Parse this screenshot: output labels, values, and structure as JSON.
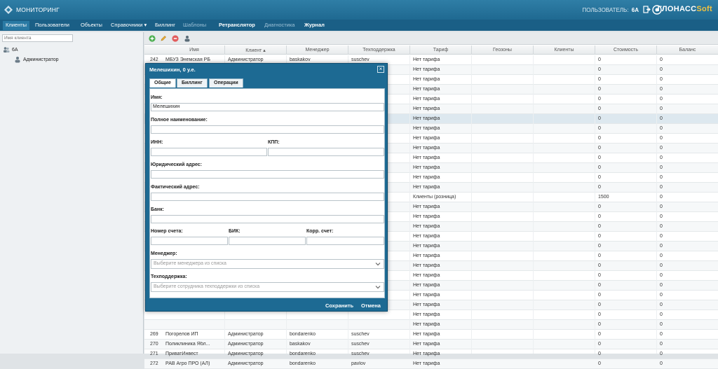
{
  "header": {
    "app_title": "МОНИТОРИНГ",
    "user_label": "ПОЛЬЗОВАТЕЛЬ:",
    "user_name": "6А",
    "brand_main": "ГЛОНАСС",
    "brand_soft": "Soft"
  },
  "menu": {
    "items": [
      "Клиенты",
      "Пользователи",
      "Объекты",
      "Справочники ▾",
      "Биллинг",
      "Шаблоны",
      "Ретранслятор",
      "Диагностика",
      "Журнал"
    ]
  },
  "left": {
    "search_placeholder": "Имя клиента",
    "tree_root": "6А",
    "tree_child": "Администратор"
  },
  "grid": {
    "columns": [
      "Имя",
      "Клиент ▴",
      "Менеджер",
      "Техподдержка",
      "Тариф",
      "Геозоны",
      "Клиенты",
      "Стоимость",
      "Баланс"
    ],
    "rows": [
      [
        "242",
        "МБУЗ Энемская РБ",
        "Администратор",
        "baskakov",
        "suschev",
        "Нет тарифа",
        "",
        "",
        "0",
        "0"
      ],
      [
        "",
        "",
        "",
        "",
        "",
        "Нет тарифа",
        "",
        "",
        "0",
        "0"
      ],
      [
        "",
        "",
        "",
        "",
        "",
        "Нет тарифа",
        "",
        "",
        "0",
        "0"
      ],
      [
        "",
        "",
        "",
        "",
        "",
        "Нет тарифа",
        "",
        "",
        "0",
        "0"
      ],
      [
        "",
        "",
        "",
        "",
        "",
        "Нет тарифа",
        "",
        "",
        "0",
        "0"
      ],
      [
        "",
        "",
        "",
        "",
        "",
        "Нет тарифа",
        "",
        "",
        "0",
        "0"
      ],
      [
        "",
        "",
        "",
        "",
        "",
        "Нет тарифа",
        "",
        "",
        "0",
        "0"
      ],
      [
        "",
        "",
        "",
        "",
        "",
        "Нет тарифа",
        "",
        "",
        "0",
        "0"
      ],
      [
        "",
        "",
        "",
        "",
        "",
        "Нет тарифа",
        "",
        "",
        "0",
        "0"
      ],
      [
        "",
        "",
        "",
        "",
        "",
        "Нет тарифа",
        "",
        "",
        "0",
        "0"
      ],
      [
        "",
        "",
        "",
        "",
        "",
        "Нет тарифа",
        "",
        "",
        "0",
        "0"
      ],
      [
        "",
        "",
        "",
        "",
        "",
        "Нет тарифа",
        "",
        "",
        "0",
        "0"
      ],
      [
        "",
        "",
        "",
        "",
        "",
        "Нет тарифа",
        "",
        "",
        "0",
        "0"
      ],
      [
        "",
        "",
        "",
        "",
        "",
        "Нет тарифа",
        "",
        "",
        "0",
        "0"
      ],
      [
        "",
        "",
        "",
        "",
        "",
        "Клиенты (розница)",
        "",
        "",
        "1500",
        "0"
      ],
      [
        "",
        "",
        "",
        "",
        "",
        "Нет тарифа",
        "",
        "",
        "0",
        "0"
      ],
      [
        "",
        "",
        "",
        "",
        "",
        "Нет тарифа",
        "",
        "",
        "0",
        "0"
      ],
      [
        "",
        "",
        "",
        "",
        "",
        "Нет тарифа",
        "",
        "",
        "0",
        "0"
      ],
      [
        "",
        "",
        "",
        "",
        "",
        "Нет тарифа",
        "",
        "",
        "0",
        "0"
      ],
      [
        "",
        "",
        "",
        "",
        "",
        "Нет тарифа",
        "",
        "",
        "0",
        "0"
      ],
      [
        "",
        "",
        "",
        "",
        "",
        "Нет тарифа",
        "",
        "",
        "0",
        "0"
      ],
      [
        "",
        "",
        "",
        "",
        "",
        "Нет тарифа",
        "",
        "",
        "0",
        "0"
      ],
      [
        "",
        "",
        "",
        "",
        "",
        "Нет тарифа",
        "",
        "",
        "0",
        "0"
      ],
      [
        "",
        "",
        "",
        "",
        "",
        "Нет тарифа",
        "",
        "",
        "0",
        "0"
      ],
      [
        "",
        "",
        "",
        "",
        "",
        "Нет тарифа",
        "",
        "",
        "0",
        "0"
      ],
      [
        "",
        "",
        "",
        "",
        "",
        "Нет тарифа",
        "",
        "",
        "0",
        "0"
      ],
      [
        "",
        "",
        "",
        "",
        "",
        "Нет тарифа",
        "",
        "",
        "0",
        "0"
      ],
      [
        "",
        "",
        "",
        "",
        "",
        "Нет тарифа",
        "",
        "",
        "0",
        "0"
      ],
      [
        "269",
        "Погорелов ИП",
        "Администратор",
        "bondarenko",
        "suschev",
        "Нет тарифа",
        "",
        "",
        "0",
        "0"
      ],
      [
        "270",
        "Поликлиника Ябл...",
        "Администратор",
        "baskakov",
        "suschev",
        "Нет тарифа",
        "",
        "",
        "0",
        "0"
      ],
      [
        "271",
        "ПриватИнвест",
        "Администратор",
        "bondarenko",
        "suschev",
        "Нет тарифа",
        "",
        "",
        "0",
        "0"
      ],
      [
        "272",
        "РАВ Агро ПРО (АЛ)",
        "Администратор",
        "bondarenko",
        "pavlov",
        "Нет тарифа",
        "",
        "",
        "0",
        "0"
      ]
    ]
  },
  "modal": {
    "title": "Мелешихин, 0 у.е.",
    "tabs": [
      "Общие",
      "Биллинг",
      "Операции"
    ],
    "name_label": "Имя:",
    "name_value": "Мелешихин",
    "fullname_label": "Полное наименование:",
    "inn_label": "ИНН:",
    "kpp_label": "КПП:",
    "legal_address_label": "Юридический адрес:",
    "actual_address_label": "Фактический адрес:",
    "bank_label": "Банк:",
    "account_label": "Номер счета:",
    "bik_label": "БИК:",
    "corr_label": "Корр. счет:",
    "manager_label": "Менеджер:",
    "manager_placeholder": "Выберите менеджера из списка",
    "support_label": "Техподдержка:",
    "support_placeholder": "Выберите сотрудника техподдержки из списка",
    "save_label": "Сохранить",
    "cancel_label": "Отмена"
  }
}
